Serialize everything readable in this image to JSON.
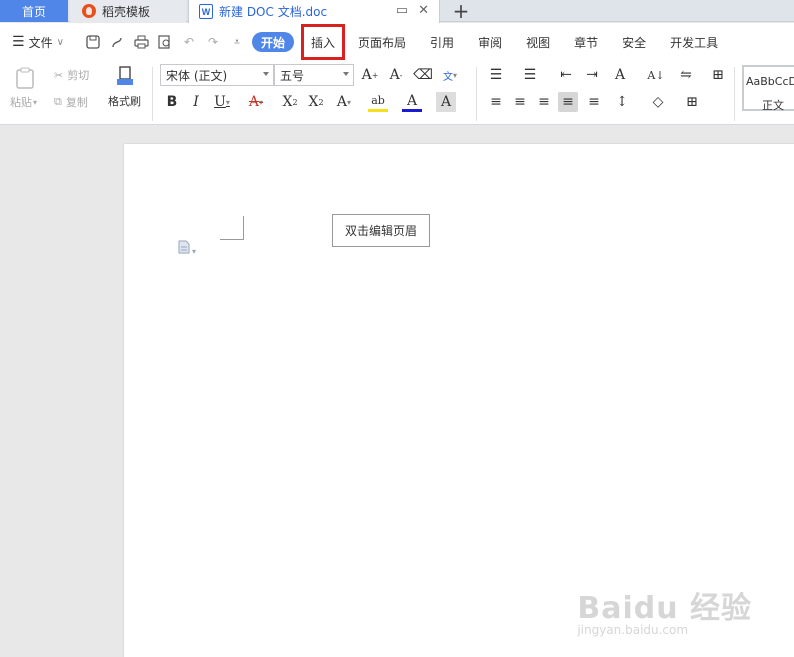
{
  "tabs": {
    "home": "首页",
    "template": "稻壳模板",
    "document": "新建 DOC 文档.doc",
    "new_tab": "+"
  },
  "menu": {
    "file": "文件",
    "start": "开始",
    "items": [
      "插入",
      "页面布局",
      "引用",
      "审阅",
      "视图",
      "章节",
      "安全",
      "开发工具"
    ],
    "highlighted": "插入"
  },
  "ribbon": {
    "paste": "粘贴",
    "cut": "剪切",
    "copy": "复制",
    "format_painter": "格式刷",
    "font_name": "宋体 (正文)",
    "font_size": "五号",
    "style_preview": "AaBbCcD",
    "style_name": "正文"
  },
  "document": {
    "header_tip": "双击编辑页眉"
  },
  "watermark": {
    "brand": "Baidu 经验",
    "url": "jingyan.baidu.com"
  },
  "colors": {
    "accent": "#4f86e8",
    "highlight_box": "#d9211f",
    "brand_flame": "#e8501e"
  }
}
